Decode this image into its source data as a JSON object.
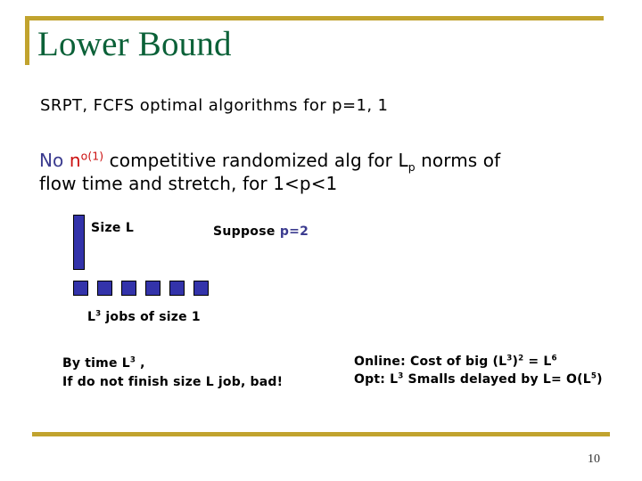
{
  "slide": {
    "title": "Lower Bound",
    "page_number": "10",
    "accent_color": "#c1a32e",
    "title_color": "#0b6138",
    "job_color": "#3333aa",
    "highlight_blue": "#3b3b8f",
    "highlight_red": "#cc1111"
  },
  "statements": {
    "line1": "SRPT, FCFS  optimal algorithms  for p=1, 1",
    "line2_part1": "No ",
    "line2_n": "n",
    "line2_n_sup": "o(1)",
    "line2_part2": " competitive  randomized alg for L",
    "line2_p_sub": "p",
    "line2_part3": " norms of",
    "line2_line2": "flow time and stretch, for 1<p<1"
  },
  "diagram": {
    "big_job_label": "Size L",
    "suppose_prefix": "Suppose ",
    "suppose_value": "p=2",
    "small_job_count": 6,
    "small_jobs_caption_prefix": "L",
    "small_jobs_caption_sup": "3",
    "small_jobs_caption_rest": " jobs of size 1"
  },
  "conclusions": {
    "left_line1_prefix": "By time L",
    "left_line1_sup": "3",
    "left_line1_suffix": " ,",
    "left_line2": "If do not finish size L job, bad!",
    "right_line1_a": "Online: Cost of big (L",
    "right_line1_sup1": "3",
    "right_line1_b": ")",
    "right_line1_sup2": "2",
    "right_line1_c": " = L",
    "right_line1_sup3": "6",
    "right_line2_a": "Opt: L",
    "right_line2_sup1": "3",
    "right_line2_b": " Smalls delayed by L= O(L",
    "right_line2_sup2": "5",
    "right_line2_c": ")"
  }
}
